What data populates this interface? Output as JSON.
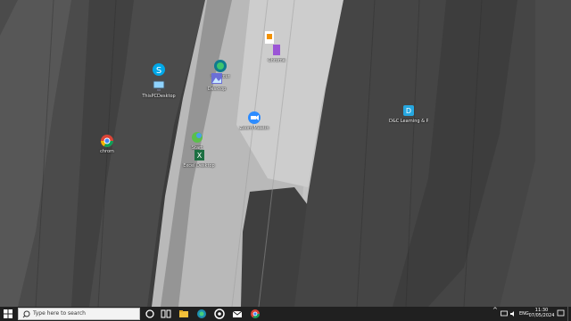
{
  "desktop": {
    "icons": [
      {
        "name": "Skype",
        "label": ""
      },
      {
        "name": "ThisPC",
        "label": "ThisPCDesktop"
      },
      {
        "name": "OpenOffice",
        "label": ""
      },
      {
        "name": "Edge",
        "label": "Shortcut"
      },
      {
        "name": "Photos",
        "label": "Desktop"
      },
      {
        "name": "App",
        "label": "Chrome"
      },
      {
        "name": "Zoom",
        "label": "Zoom Meetin"
      },
      {
        "name": "FolderApp",
        "label": "Start"
      },
      {
        "name": "Excel",
        "label": "Excel Desktop"
      },
      {
        "name": "Chrome",
        "label": "chrom"
      },
      {
        "name": "Sync",
        "label": "D&C Learning & Payment"
      }
    ]
  },
  "taskbar": {
    "search_placeholder": "Type here to search",
    "tray": {
      "language": "ENG",
      "time": "11:30",
      "date": "07/05/2024"
    }
  },
  "colors": {
    "taskbar": "#202020",
    "search_bg": "#f3f3f3"
  }
}
